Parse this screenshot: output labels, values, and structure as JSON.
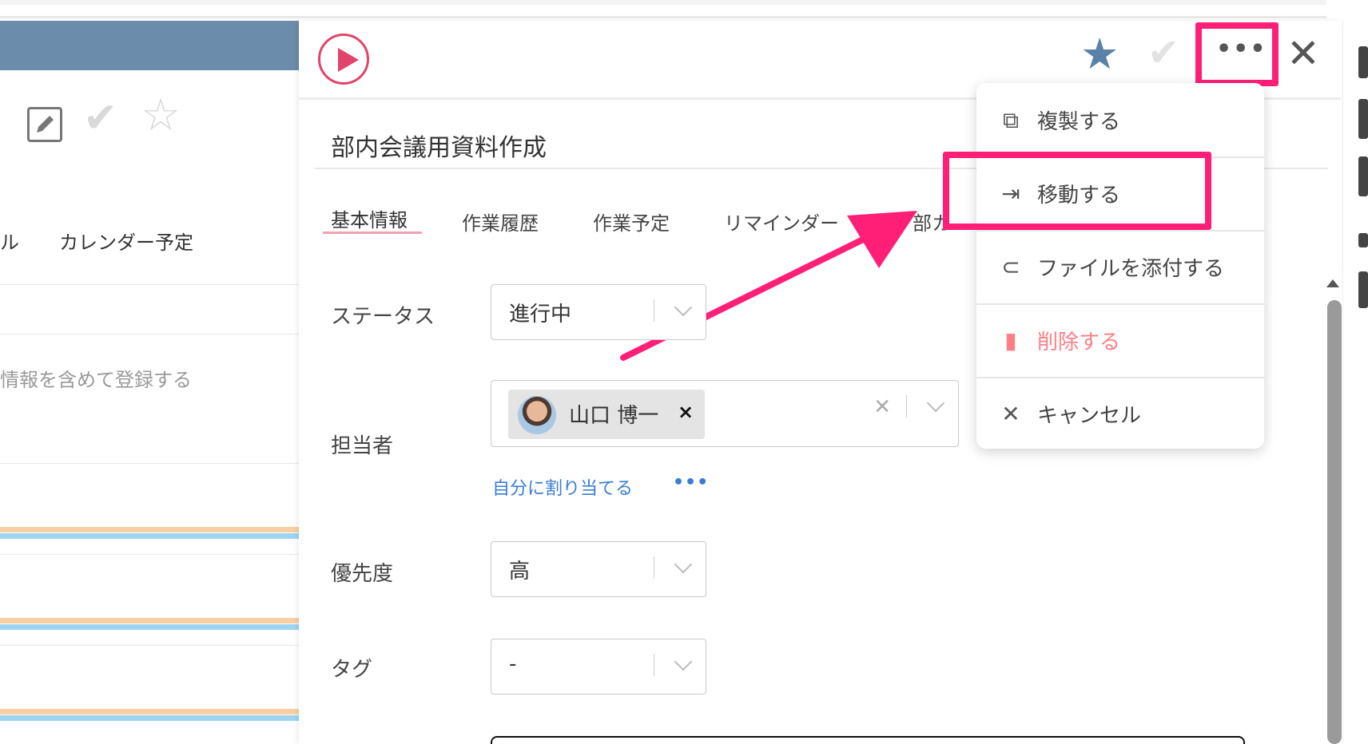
{
  "left_panel": {
    "tab_partial_label": "ル",
    "tab_calendar_label": "カレンダー予定",
    "placeholder_partial": "情報を含めて登録する"
  },
  "task": {
    "title": "部内会議用資料作成",
    "tabs": [
      "基本情報",
      "作業履歴",
      "作業予定",
      "リマインダー",
      "部カ"
    ],
    "status_label": "ステータス",
    "status_value": "進行中",
    "assignee_label": "担当者",
    "assignee_name": "山口 博一",
    "assignee_remove": "×",
    "assign_self_link": "自分に割り当てる",
    "more_dots": "•••",
    "priority_label": "優先度",
    "priority_value": "高",
    "tag_label": "タグ",
    "tag_value": "-"
  },
  "header": {
    "more_dots": "•••"
  },
  "menu": {
    "items": [
      {
        "label": "複製する",
        "icon": "copy-icon"
      },
      {
        "label": "移動する",
        "icon": "move-icon"
      },
      {
        "label": "ファイルを添付する",
        "icon": "paperclip-icon"
      },
      {
        "label": "削除する",
        "icon": "trash-icon"
      },
      {
        "label": "キャンセル",
        "icon": "close-icon"
      }
    ]
  },
  "colors": {
    "accent_highlight": "#ff1f77",
    "play_icon": "#e0446a",
    "star_active": "#5a82a8",
    "left_header": "#6b8cab",
    "link": "#3a7bd5",
    "danger": "#ff7f87"
  }
}
